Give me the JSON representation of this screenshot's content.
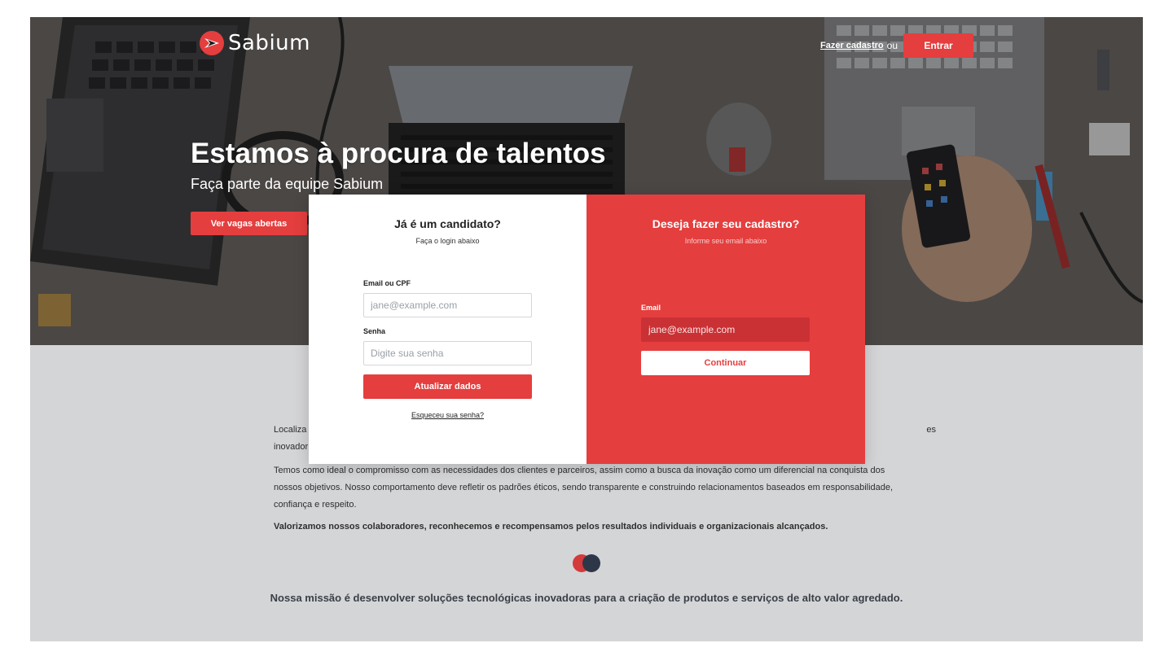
{
  "header": {
    "logo_text": "Sabium",
    "register_link": "Fazer cadastro",
    "or_text": "ou",
    "login_button": "Entrar"
  },
  "hero": {
    "title": "Estamos à procura de talentos",
    "subtitle": "Faça parte da equipe Sabium",
    "cta_button": "Ver vagas abertas"
  },
  "login_panel": {
    "title": "Já é um candidato?",
    "subtitle": "Faça o login abaixo",
    "email_label": "Email ou CPF",
    "email_placeholder": "jane@example.com",
    "password_label": "Senha",
    "password_placeholder": "Digite sua senha",
    "submit_button": "Atualizar dados",
    "forgot_link": "Esqueceu sua senha?"
  },
  "signup_panel": {
    "title": "Deseja fazer seu cadastro?",
    "subtitle": "Informe seu email abaixo",
    "email_label": "Email",
    "email_placeholder": "jane@example.com",
    "continue_button": "Continuar"
  },
  "about": {
    "paragraph_1_visible": "Localiza                                                                                                                                                                                                                                            es inovador",
    "paragraph_2": "Temos como ideal o compromisso com as necessidades dos clientes e parceiros, assim como a busca da inovação como um diferencial na conquista dos nossos objetivos. Nosso comportamento deve refletir os padrões éticos, sendo transparente e construindo relacionamentos baseados em responsabilidade, confiança e respeito.",
    "paragraph_3": "Valorizamos nossos colaboradores, reconhecemos e recompensamos pelos resultados individuais e organizacionais alcançados.",
    "mission": "Nossa missão é desenvolver soluções tecnológicas inovadoras para a criação de produtos e serviços de alto valor agredado."
  },
  "colors": {
    "brand_red": "#e53e3e",
    "dark_navy": "#2d3748",
    "lower_bg": "#d4d5d7"
  }
}
